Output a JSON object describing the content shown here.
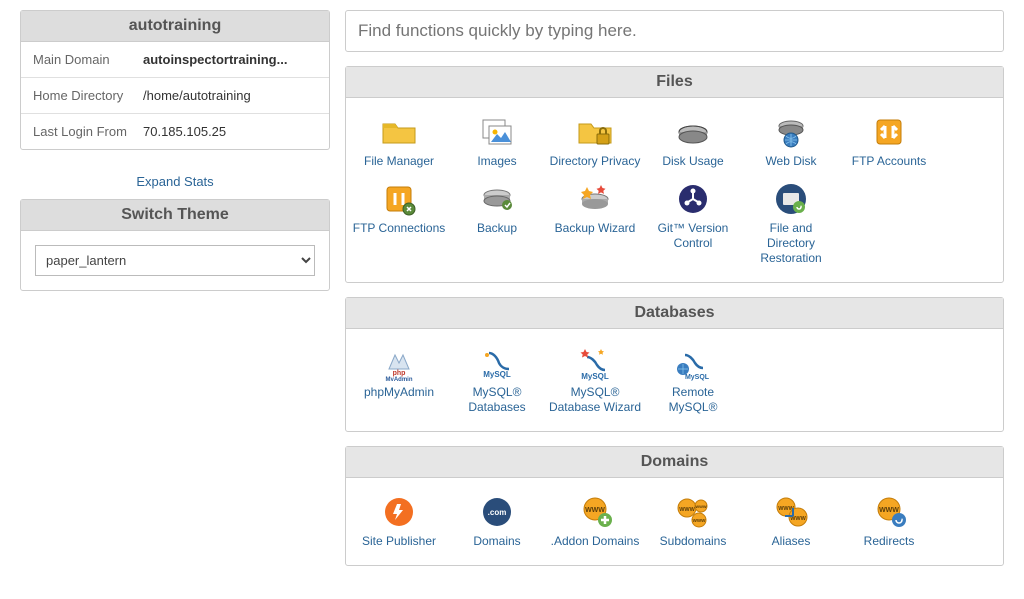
{
  "left": {
    "account": {
      "title": "autotraining",
      "rows": [
        {
          "label": "Main Domain",
          "value": "autoinspectortraining...",
          "bold": true
        },
        {
          "label": "Home Directory",
          "value": "/home/autotraining",
          "bold": false
        },
        {
          "label": "Last Login From",
          "value": "70.185.105.25",
          "bold": false
        }
      ],
      "expand": "Expand Stats"
    },
    "theme": {
      "title": "Switch Theme",
      "value": "paper_lantern"
    }
  },
  "search": {
    "placeholder": "Find functions quickly by typing here."
  },
  "sections": {
    "files": {
      "title": "Files",
      "items": [
        {
          "label": "File Manager",
          "icon": "folder"
        },
        {
          "label": "Images",
          "icon": "images"
        },
        {
          "label": "Directory Privacy",
          "icon": "folder-lock"
        },
        {
          "label": "Disk Usage",
          "icon": "disk"
        },
        {
          "label": "Web Disk",
          "icon": "webdisk"
        },
        {
          "label": "FTP Accounts",
          "icon": "ftp-accounts"
        },
        {
          "label": "FTP Connections",
          "icon": "ftp-conn"
        },
        {
          "label": "Backup",
          "icon": "backup"
        },
        {
          "label": "Backup Wizard",
          "icon": "backup-wiz"
        },
        {
          "label": "Git™ Version Control",
          "icon": "git"
        },
        {
          "label": "File and Directory Restoration",
          "icon": "restore"
        }
      ]
    },
    "databases": {
      "title": "Databases",
      "items": [
        {
          "label": "phpMyAdmin",
          "icon": "phpmyadmin"
        },
        {
          "label": "MySQL® Databases",
          "icon": "mysql"
        },
        {
          "label": "MySQL® Database Wizard",
          "icon": "mysql-wiz"
        },
        {
          "label": "Remote MySQL®",
          "icon": "mysql-remote"
        }
      ]
    },
    "domains": {
      "title": "Domains",
      "items": [
        {
          "label": "Site Publisher",
          "icon": "publisher"
        },
        {
          "label": "Domains",
          "icon": "domains"
        },
        {
          "label": ".Addon Domains",
          "icon": "addon"
        },
        {
          "label": "Subdomains",
          "icon": "subdomains"
        },
        {
          "label": "Aliases",
          "icon": "aliases"
        },
        {
          "label": "Redirects",
          "icon": "redirects"
        }
      ]
    }
  }
}
